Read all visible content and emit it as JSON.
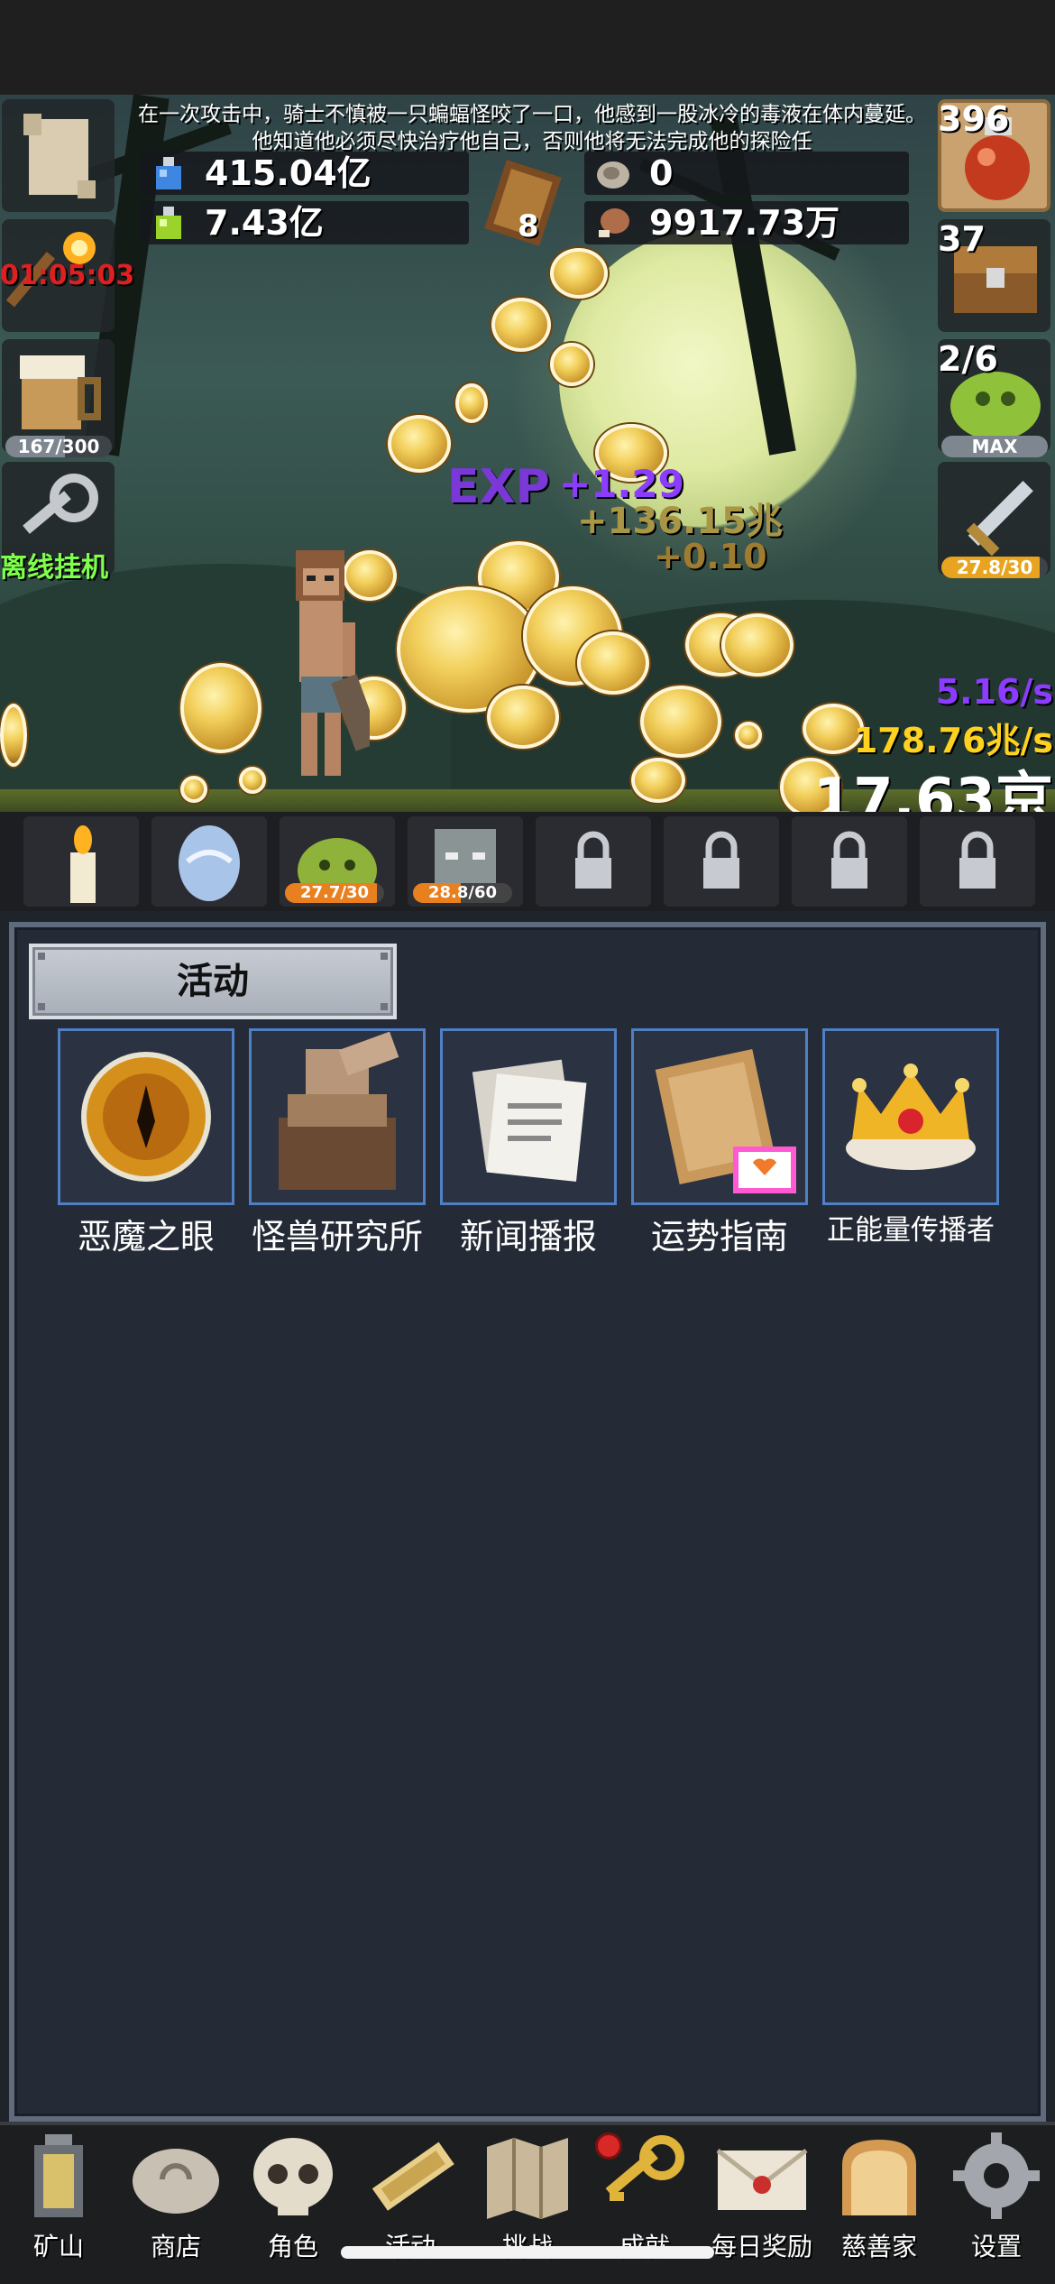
{
  "story": {
    "line1": "在一次攻击中，骑士不慎被一只蝙蝠怪咬了一口，他感到一股冰冷的毒液在体内蔓延。",
    "line2": "他知道他必须尽快治疗他自己，否则他将无法完成他的探险任"
  },
  "resources": {
    "blue_potion": "415.04亿",
    "green_potion": "7.43亿",
    "book_count": "8",
    "stone": "0",
    "meat": "9917.73万"
  },
  "left_panel": {
    "timer": "01:05:03",
    "beer_progress_text": "167/300",
    "beer_progress": 0.557,
    "offline_label": "离线挂机"
  },
  "right_panel": {
    "potion_count": "396",
    "chest_count": "37",
    "slime_text": "2/6",
    "slime_bar": "MAX",
    "sword_progress_text": "27.8/30",
    "sword_progress": 0.927
  },
  "scene": {
    "exp_label": "EXP",
    "exp_gain": "+1.29",
    "gold_gain": "+136.15兆",
    "small_gain": "+0.10",
    "exp_rate": "5.16/s",
    "gold_rate": "178.76兆/s",
    "total_gold": "17.63京"
  },
  "monsters": [
    {
      "icon": "candle-icon",
      "locked": false
    },
    {
      "icon": "egg-icon",
      "locked": false
    },
    {
      "icon": "slime-icon",
      "locked": false,
      "progress_text": "27.7/30",
      "progress": 0.923
    },
    {
      "icon": "zombie-icon",
      "locked": false,
      "progress_text": "28.8/60",
      "progress": 0.48
    },
    {
      "icon": "lock-icon",
      "locked": true
    },
    {
      "icon": "lock-icon",
      "locked": true
    },
    {
      "icon": "lock-icon",
      "locked": true
    },
    {
      "icon": "lock-icon",
      "locked": true
    }
  ],
  "panel": {
    "title": "活动",
    "activities": [
      {
        "label": "恶魔之眼",
        "icon": "demon-eye-icon"
      },
      {
        "label": "怪兽研究所",
        "icon": "monster-lab-icon"
      },
      {
        "label": "新闻播报",
        "icon": "newspaper-icon"
      },
      {
        "label": "运势指南",
        "icon": "fortune-guide-icon"
      },
      {
        "label": "正能量传播者",
        "icon": "crown-icon"
      }
    ]
  },
  "nav": {
    "items": [
      {
        "label": "矿山",
        "icon": "lantern-icon"
      },
      {
        "label": "商店",
        "icon": "shop-stone-icon"
      },
      {
        "label": "角色",
        "icon": "skull-icon"
      },
      {
        "label": "活动",
        "icon": "scroll-icon"
      },
      {
        "label": "挑战",
        "icon": "map-icon"
      },
      {
        "label": "成就",
        "icon": "key-icon",
        "badge": true
      },
      {
        "label": "每日奖励",
        "icon": "mail-icon"
      },
      {
        "label": "慈善家",
        "icon": "bread-icon"
      },
      {
        "label": "设置",
        "icon": "gear-icon"
      }
    ]
  },
  "colors": {
    "timer": "#e02020",
    "offline": "#7dff4c",
    "exp_rate": "#8b3cff",
    "gold_rate": "#ffd21f",
    "bar_orange": "#e8801f",
    "frame_blue": "#4f7fc4"
  }
}
